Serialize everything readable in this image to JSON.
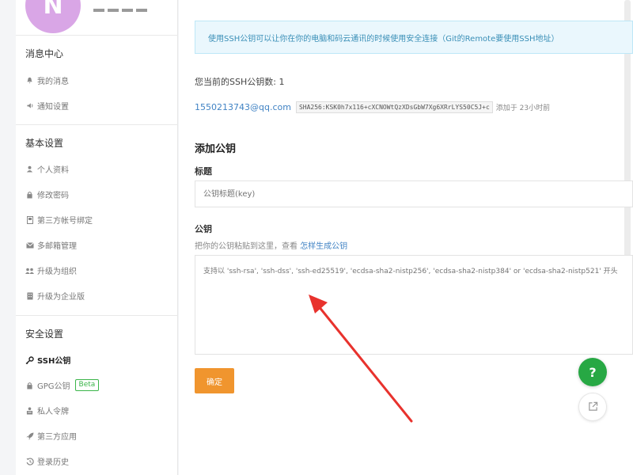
{
  "sidebar": {
    "avatar_letter": "N",
    "groups": [
      {
        "title": "消息中心",
        "items": [
          {
            "label": "我的消息",
            "icon": "bell-icon"
          },
          {
            "label": "通知设置",
            "icon": "speaker-icon"
          }
        ]
      },
      {
        "title": "基本设置",
        "items": [
          {
            "label": "个人资料",
            "icon": "user-icon"
          },
          {
            "label": "修改密码",
            "icon": "lock-icon"
          },
          {
            "label": "第三方帐号绑定",
            "icon": "bookmark-icon"
          },
          {
            "label": "多邮箱管理",
            "icon": "mail-icon"
          },
          {
            "label": "升级为组织",
            "icon": "group-icon"
          },
          {
            "label": "升级为企业版",
            "icon": "building-icon"
          }
        ]
      },
      {
        "title": "安全设置",
        "items": [
          {
            "label": "SSH公钥",
            "icon": "key-icon",
            "active": true
          },
          {
            "label": "GPG公钥",
            "icon": "lock-icon",
            "badge": "Beta"
          },
          {
            "label": "私人令牌",
            "icon": "token-icon"
          },
          {
            "label": "第三方应用",
            "icon": "rocket-icon"
          },
          {
            "label": "登录历史",
            "icon": "history-icon"
          }
        ]
      }
    ]
  },
  "main": {
    "info_text": "使用SSH公钥可以让你在你的电脑和码云通讯的时候使用安全连接（Git的Remote要使用SSH地址）",
    "count_text": "您当前的SSH公钥数: 1",
    "key": {
      "email": "1550213743@qq.com",
      "fingerprint": "SHA256:KSK0h7x116+cXCNOWtQzXDsGbW7Xg6XRrLYS50C5J+c",
      "added": "添加于 23小时前"
    },
    "add_title": "添加公钥",
    "title_label": "标题",
    "title_placeholder": "公钥标题(key)",
    "key_label": "公钥",
    "hint_prefix": "把你的公钥粘贴到这里，查看",
    "hint_link": "怎样生成公钥",
    "key_placeholder": "支持以 'ssh-rsa', 'ssh-dss', 'ssh-ed25519', 'ecdsa-sha2-nistp256', 'ecdsa-sha2-nistp384' or 'ecdsa-sha2-nistp521' 开头",
    "confirm_label": "确定",
    "help_label": "?"
  },
  "colors": {
    "accent_orange": "#f0952e",
    "link_blue": "#4183c4",
    "help_green": "#27a844",
    "arrow_red": "#e8322d"
  }
}
